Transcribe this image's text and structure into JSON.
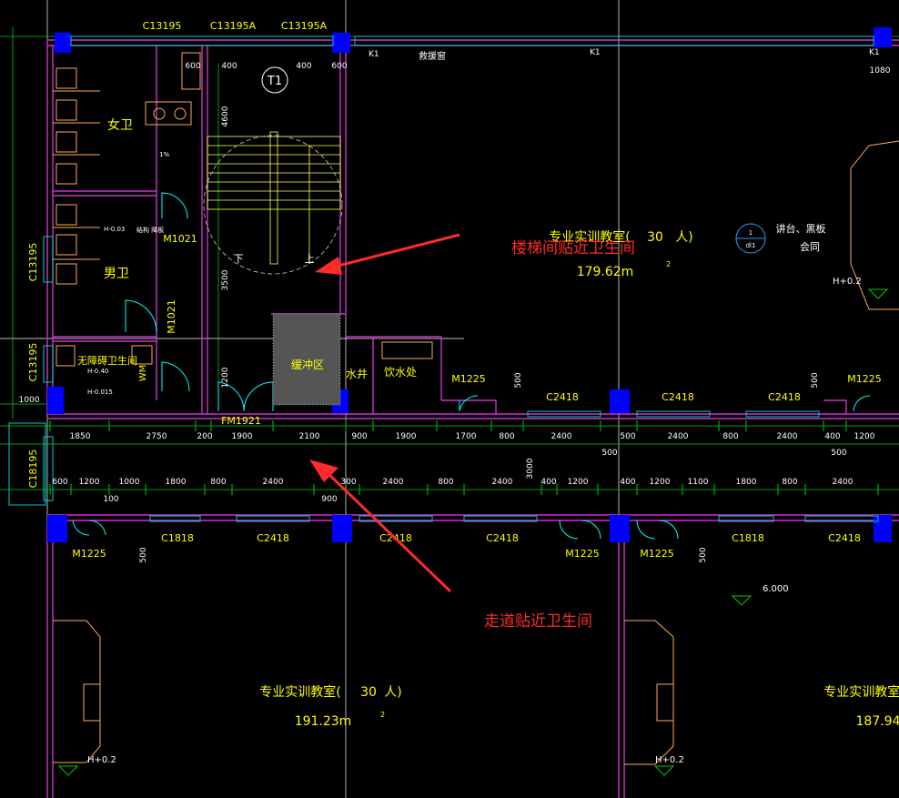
{
  "windows_top": [
    "C13195",
    "C13195A",
    "C13195A"
  ],
  "windows_left": [
    "C13195",
    "C13195",
    "C18195"
  ],
  "stair": {
    "tag": "T1",
    "up": "上",
    "down": "下",
    "door": "FM1921"
  },
  "rooms": {
    "female_wc": "女卫",
    "male_wc": "男卫",
    "accessible_wc": "无障碍卫生间",
    "buffer": "缓冲区",
    "water_well": "水井",
    "drinking": "饮水处",
    "tag_wm": "WM",
    "rescue": "救援窗",
    "struct": "结构\n降板",
    "classroom_name": "专业实训教室(",
    "classroom_people": "30",
    "classroom_unit": "人)",
    "area_a": "179.62m",
    "area_b": "191.23m",
    "area_c": "187.94",
    "sq": "2",
    "lectern": "讲台、黑板",
    "lectern2": "会同",
    "level_a": "H+0.2",
    "level_b": "6.000",
    "detail_top": "1",
    "detail_bot": "dl1"
  },
  "doors": [
    "M1021",
    "M1021",
    "M1225",
    "M1225",
    "M1225",
    "M1225",
    "M1921"
  ],
  "windows_corridor": [
    "C2418",
    "C2418",
    "C2418",
    "C1818",
    "C2418",
    "C2418",
    "C2418",
    "C1818",
    "C2418"
  ],
  "small_tags": [
    "K1",
    "K1",
    "K1",
    "H-0.40",
    "H-0.03",
    "H-0.015",
    "1%"
  ],
  "dims_row1": [
    "1850",
    "2750",
    "200",
    "1900",
    "2100",
    "900",
    "1900",
    "1700",
    "800",
    "2400",
    "500",
    "2400",
    "800",
    "2400",
    "400",
    "1200"
  ],
  "dims_row2": [
    "600",
    "1200",
    "1000",
    "1800",
    "800",
    "2400",
    "300",
    "2400",
    "800",
    "2400",
    "400",
    "1200",
    "400",
    "1200",
    "1100",
    "1800",
    "800",
    "2400"
  ],
  "dims_misc": [
    "600",
    "400",
    "400",
    "600",
    "1080",
    "4600",
    "3500",
    "1200",
    "500",
    "500",
    "500",
    "100",
    "900",
    "3000",
    "500",
    "500",
    "500",
    "1000"
  ],
  "annotations": [
    "楼梯间贴近卫生间",
    "走道贴近卫生间"
  ],
  "colors": {
    "wall": "#cc33cc",
    "text": "#ffff00",
    "dim": "#00cc00",
    "column": "#0000ff",
    "window": "#00cccc",
    "annotation": "#ff2a2a",
    "furniture": "#ffaa55"
  }
}
